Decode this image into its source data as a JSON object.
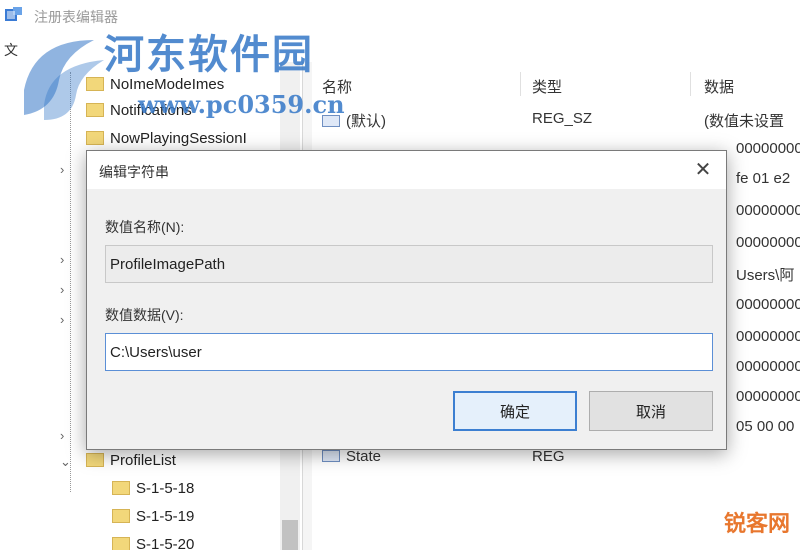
{
  "window": {
    "title": "注册表编辑器"
  },
  "menu": {
    "file": "文"
  },
  "tree": {
    "items": [
      {
        "label": "NoImeModeImes"
      },
      {
        "label": "Notifications"
      },
      {
        "label": "NowPlayingSessionI"
      },
      {
        "label": "ProfileList"
      },
      {
        "label": "S-1-5-18"
      },
      {
        "label": "S-1-5-19"
      },
      {
        "label": "S-1-5-20"
      }
    ],
    "expand_glyph": "›",
    "collapse_glyph": "⌄"
  },
  "list": {
    "columns": {
      "name": "名称",
      "type": "类型",
      "data": "数据"
    },
    "rows": [
      {
        "name": "(默认)",
        "type": "REG_SZ",
        "data": "(数值未设置"
      },
      {
        "name": "",
        "type": "",
        "data": "00000000"
      },
      {
        "name": "",
        "type": "",
        "data": "fe 01 e2"
      },
      {
        "name": "",
        "type": "",
        "data": "00000000"
      },
      {
        "name": "",
        "type": "",
        "data": "00000000"
      },
      {
        "name": "",
        "type": "",
        "data": "Users\\阿"
      },
      {
        "name": "",
        "type": "",
        "data": "00000000"
      },
      {
        "name": "",
        "type": "",
        "data": "00000000"
      },
      {
        "name": "",
        "type": "",
        "data": "00000000"
      },
      {
        "name": "",
        "type": "",
        "data": "00000000"
      },
      {
        "name": "",
        "type": "",
        "data": "05 00 00"
      },
      {
        "name": "State",
        "type": "REG",
        "data": ""
      }
    ]
  },
  "dialog": {
    "title": "编辑字符串",
    "close_glyph": "✕",
    "name_label": "数值名称(N):",
    "name_value": "ProfileImagePath",
    "data_label": "数值数据(V):",
    "data_value": "C:\\Users\\user",
    "ok_label": "确定",
    "cancel_label": "取消"
  },
  "watermark": {
    "site_name": "河东软件园",
    "site_url": "www.pc0359.cn",
    "corner_mark": "锐客网"
  },
  "colors": {
    "accent": "#3c7fd1",
    "watermark_blue": "#3477c7",
    "folder": "#f2d77a",
    "corner_mark": "#e8772e"
  }
}
